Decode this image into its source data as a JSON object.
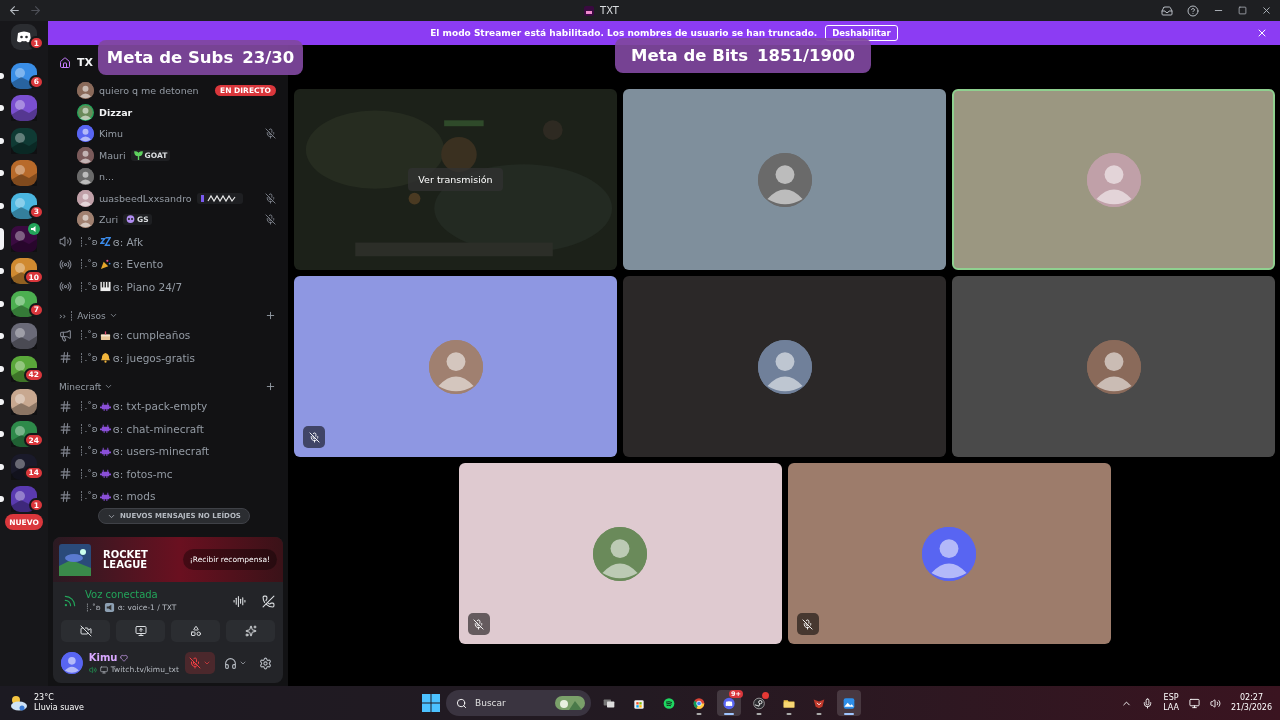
{
  "title_bar": {
    "title": "TXT"
  },
  "streamer_banner": {
    "message": "El modo Streamer está habilitado. Los nombres de usuario se han truncado.",
    "button": "Deshabilitar"
  },
  "goal_overlays": [
    {
      "label": "Meta de Subs",
      "value": "23/30"
    },
    {
      "label": "Meta de Bits",
      "value": "1851/1900"
    }
  ],
  "servers": [
    {
      "kind": "home",
      "badge": "1",
      "selected": false,
      "unread": false,
      "voice": false,
      "color": "#2b2d31"
    },
    {
      "kind": "guild",
      "badge": "6",
      "selected": false,
      "unread": true,
      "voice": false,
      "color": "#3a8ee6"
    },
    {
      "kind": "guild",
      "selected": false,
      "unread": true,
      "voice": false,
      "color": "#7a4fd0"
    },
    {
      "kind": "guild",
      "selected": false,
      "unread": true,
      "voice": false,
      "color": "#0f3a34"
    },
    {
      "kind": "guild",
      "selected": false,
      "unread": true,
      "voice": false,
      "color": "#b86a2a"
    },
    {
      "kind": "guild",
      "badge": "3",
      "selected": false,
      "unread": true,
      "voice": false,
      "color": "#4bb6e0"
    },
    {
      "kind": "guild",
      "selected": true,
      "unread": false,
      "voice": true,
      "color": "#3a0a40"
    },
    {
      "kind": "guild",
      "badge": "10",
      "selected": false,
      "unread": true,
      "voice": false,
      "color": "#d08a30"
    },
    {
      "kind": "guild",
      "badge": "7",
      "selected": false,
      "unread": true,
      "voice": false,
      "color": "#4caf50"
    },
    {
      "kind": "guild",
      "selected": false,
      "unread": true,
      "voice": false,
      "color": "#6a6a78"
    },
    {
      "kind": "guild",
      "badge": "42",
      "selected": false,
      "unread": true,
      "voice": false,
      "color": "#5aa83a"
    },
    {
      "kind": "guild",
      "selected": false,
      "unread": true,
      "voice": false,
      "color": "#c8a890"
    },
    {
      "kind": "guild",
      "badge": "24",
      "selected": false,
      "unread": true,
      "voice": false,
      "color": "#2e8a4a"
    },
    {
      "kind": "guild",
      "badge": "14",
      "selected": false,
      "unread": true,
      "voice": false,
      "color": "#1a1a2a"
    },
    {
      "kind": "guild",
      "badge": "1",
      "selected": false,
      "unread": true,
      "voice": false,
      "color": "#5a3ab0"
    }
  ],
  "new_pill": "NUEVO",
  "sidebar": {
    "server_name": "TX"
  },
  "voice_members": [
    {
      "name": "quiero q me detonen",
      "live_badge": "EN DIRECTO",
      "speaking": false,
      "muted": false
    },
    {
      "name": "Dizzar",
      "speaking": true,
      "muted": false
    },
    {
      "name": "Kimu",
      "speaking": false,
      "muted": true
    },
    {
      "name": "Mauri",
      "tag": {
        "text": "GOAT",
        "kind": "plant"
      },
      "speaking": false,
      "muted": false
    },
    {
      "name": "n...",
      "speaking": false,
      "muted": false
    },
    {
      "name": "ɯasbeedLxxsandro",
      "tag": {
        "kind": "scribble"
      },
      "speaking": false,
      "muted": true
    },
    {
      "name": "Zuri",
      "tag": {
        "text": "GS",
        "kind": "skull"
      },
      "speaking": false,
      "muted": true
    }
  ],
  "channel_groups": [
    {
      "channels": [
        {
          "kind": "voice",
          "deco": "┊.˚ʚ",
          "emoji": {
            "kind": "sleep"
          },
          "name": "ɞ: Afk"
        },
        {
          "kind": "stage",
          "deco": "┊.˚ʚ",
          "emoji": {
            "kind": "party"
          },
          "name": "ɞ: Evento"
        },
        {
          "kind": "stage",
          "deco": "┊.˚ʚ",
          "emoji": {
            "kind": "piano"
          },
          "name": "ɞ: Piano 24/7"
        }
      ]
    },
    {
      "category": "›› ┊ Avisos",
      "collapsed": false,
      "channels": [
        {
          "kind": "announcement",
          "deco": "┊.˚ʚ",
          "emoji": {
            "kind": "cake"
          },
          "name": "ɞ: cumpleaños"
        },
        {
          "kind": "text",
          "deco": "┊.˚ʚ",
          "emoji": {
            "kind": "bell"
          },
          "name": "ɞ: juegos-gratis"
        }
      ]
    },
    {
      "category": "Minecraft",
      "collapsed": false,
      "channels": [
        {
          "kind": "text",
          "deco": "┊.˚ʚ",
          "emoji": {
            "kind": "invader"
          },
          "name": "ɞ: txt-pack-empty"
        },
        {
          "kind": "text",
          "deco": "┊.˚ʚ",
          "emoji": {
            "kind": "invader"
          },
          "name": "ɞ: chat-minecraft"
        },
        {
          "kind": "text",
          "deco": "┊.˚ʚ",
          "emoji": {
            "kind": "invader"
          },
          "name": "ɞ: users-minecraft"
        },
        {
          "kind": "text",
          "deco": "┊.˚ʚ",
          "emoji": {
            "kind": "invader"
          },
          "name": "ɞ: fotos-mc"
        },
        {
          "kind": "text",
          "deco": "┊.˚ʚ",
          "emoji": {
            "kind": "invader"
          },
          "name": "ɞ: mods"
        }
      ]
    }
  ],
  "unread_banner": "NUEVOS MENSAJES NO LEÍDOS",
  "promo": {
    "logo": [
      "ROCKET",
      "LEAGUE"
    ],
    "button": "¡Recibir recompensa!"
  },
  "voice_connection": {
    "status": "Voz conectada",
    "deco": "┊.˚ʚ",
    "channel": "ɞ: voice-1 / TXT"
  },
  "user_panel": {
    "name": "Kimu",
    "status": "Twitch.tv/kimu_txt",
    "muted": true
  },
  "tiles": [
    {
      "kind": "stream",
      "button": "Ver transmisión",
      "color": "#1c2119",
      "speaking": false,
      "muted": false
    },
    {
      "kind": "user",
      "color": "#7f8f9c",
      "speaking": false,
      "muted": false
    },
    {
      "kind": "user",
      "color": "#9b9781",
      "speaking": true,
      "muted": false
    },
    {
      "kind": "user",
      "color": "#8e97e2",
      "speaking": false,
      "muted": true
    },
    {
      "kind": "user",
      "color": "#2b2828",
      "speaking": false,
      "muted": false
    },
    {
      "kind": "user",
      "color": "#4a4a4a",
      "speaking": false,
      "muted": false
    },
    {
      "kind": "user",
      "color": "#dfcad0",
      "speaking": false,
      "muted": true
    },
    {
      "kind": "user",
      "color": "#9d7c6b",
      "speaking": false,
      "muted": true
    }
  ],
  "taskbar": {
    "weather": {
      "temp": "23°C",
      "description": "Lluvia suave"
    },
    "search_placeholder": "Buscar",
    "apps": [
      {
        "kind": "taskview",
        "selected": false,
        "running": false,
        "alert": false
      },
      {
        "kind": "store",
        "selected": false,
        "running": false,
        "alert": false
      },
      {
        "kind": "spotify",
        "selected": false,
        "running": false,
        "alert": false
      },
      {
        "kind": "chrome",
        "selected": false,
        "running": true,
        "alert": false
      },
      {
        "kind": "discord",
        "badge": "9+",
        "selected": true,
        "running": true,
        "alert": false
      },
      {
        "kind": "steam",
        "selected": false,
        "running": true,
        "alert": true
      },
      {
        "kind": "explorer",
        "selected": false,
        "running": true,
        "alert": false
      },
      {
        "kind": "mapp",
        "selected": false,
        "running": true,
        "alert": false
      },
      {
        "kind": "paint",
        "selected": true,
        "running": true,
        "alert": false
      }
    ],
    "tray": {
      "language": "ESP",
      "layout": "LAA",
      "time": "02:27",
      "date": "21/3/2026"
    }
  }
}
